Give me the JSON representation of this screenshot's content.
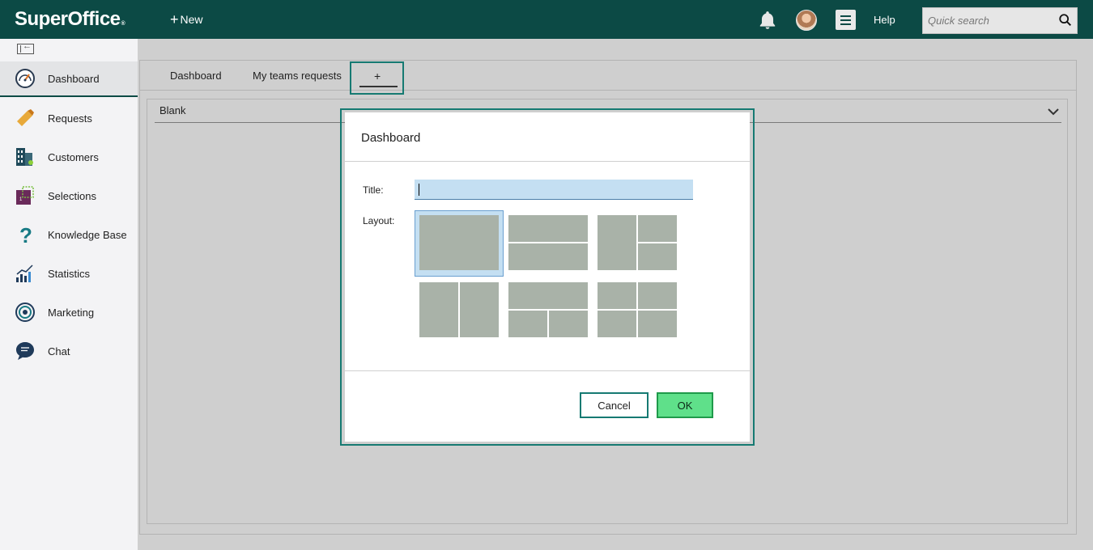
{
  "app": {
    "logo": "SuperOffice",
    "logo_mark": "®",
    "new_label": "New",
    "help_label": "Help",
    "search_placeholder": "Quick search"
  },
  "sidebar": {
    "items": [
      {
        "label": "Dashboard",
        "icon": "dashboard-gauge-icon",
        "active": true
      },
      {
        "label": "Requests",
        "icon": "ticket-icon"
      },
      {
        "label": "Customers",
        "icon": "building-icon"
      },
      {
        "label": "Selections",
        "icon": "selection-icon"
      },
      {
        "label": "Knowledge Base",
        "icon": "question-mark-icon"
      },
      {
        "label": "Statistics",
        "icon": "bar-chart-icon"
      },
      {
        "label": "Marketing",
        "icon": "target-icon"
      },
      {
        "label": "Chat",
        "icon": "chat-bubble-icon"
      }
    ]
  },
  "main": {
    "tabs": [
      {
        "label": "Dashboard"
      },
      {
        "label": "My teams requests"
      }
    ],
    "add_tab_label": "+",
    "section_title": "Blank"
  },
  "dialog": {
    "title": "Dashboard",
    "title_field_label": "Title:",
    "title_value": "",
    "layout_label": "Layout:",
    "layouts": [
      "single",
      "two-rows",
      "left-big-right-split",
      "two-columns",
      "top-wide-bottom-split",
      "four-grid"
    ],
    "selected_layout": 0,
    "cancel_label": "Cancel",
    "ok_label": "OK"
  },
  "colors": {
    "topbar": "#0c4a45",
    "accent": "#167a72",
    "ok_button": "#5fe08a",
    "input_bg": "#c4dff2",
    "layout_cell": "#a9b2a8"
  }
}
